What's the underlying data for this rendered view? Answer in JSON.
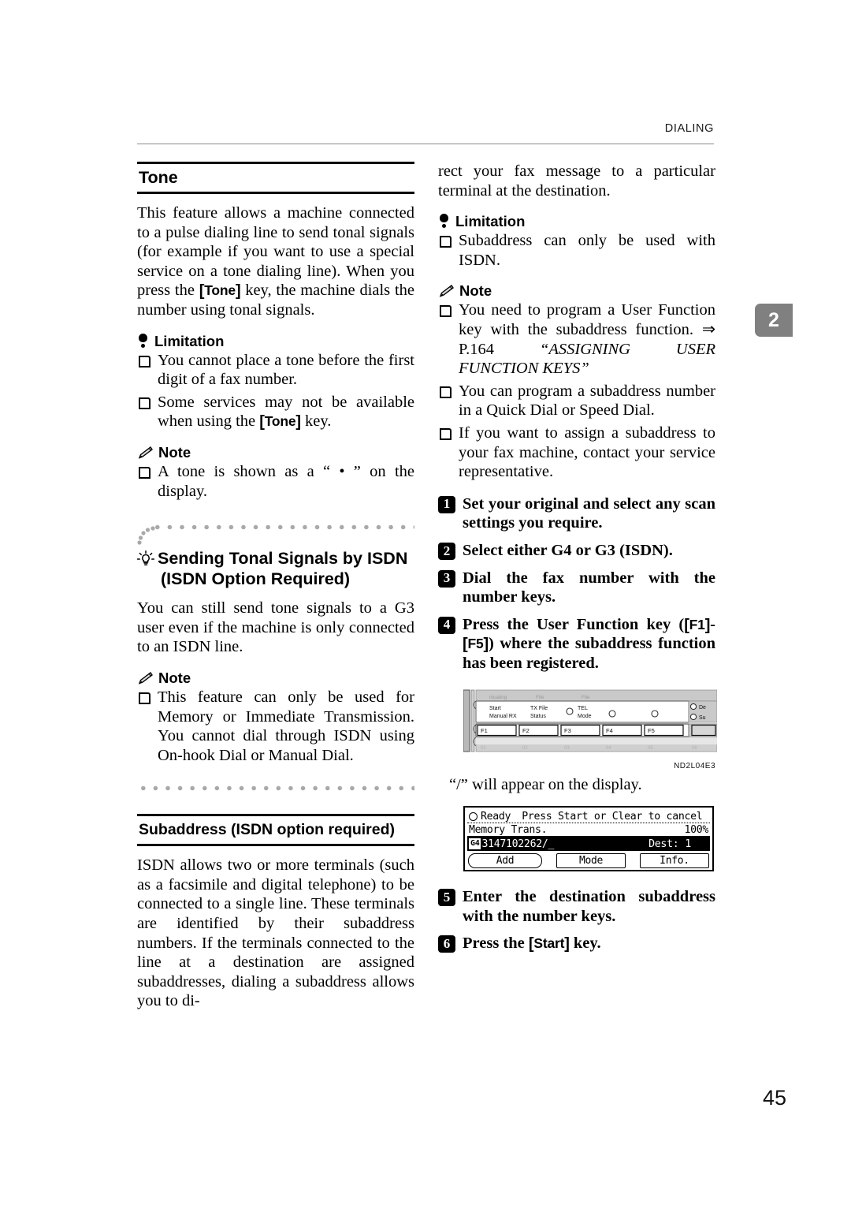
{
  "header": {
    "running_head": "DIALING"
  },
  "chapter_tab": {
    "number": "2"
  },
  "folio": {
    "page_number": "45"
  },
  "left_column": {
    "heading_tone": "Tone",
    "tone_paragraph_1": "This feature allows a machine connected to a pulse dialing line to send tonal signals (for example if you want to use a special service on a tone dialing line). When you press the ",
    "tone_keycap": "Tone",
    "tone_paragraph_2": " key, the machine dials the number using tonal signals.",
    "limitation_label": "Limitation",
    "limitation_items": [
      "You cannot place a tone before the first digit of a fax number.",
      "Some services may not be available when using the "
    ],
    "limitation_item2_keycap": "Tone",
    "limitation_item2_tail": " key.",
    "note_label": "Note",
    "note_items": [
      "A tone is shown as a “ • ” on the display."
    ],
    "heading_isdn_line1": "Sending Tonal Signals by ISDN",
    "heading_isdn_line2": "(ISDN Option Required)",
    "isdn_paragraph": "You can still send tone signals to a G3 user even if the machine is only connected to an ISDN line.",
    "note2_label": "Note",
    "note2_items": [
      "This feature can only be used for Memory or Immediate Transmission. You cannot dial through ISDN using On-hook Dial or Manual Dial."
    ],
    "heading_subaddress": "Subaddress (ISDN option required)",
    "subaddress_paragraph": "ISDN allows two or more terminals (such as a facsimile and digital telephone) to be connected to a single line. These terminals are identified by their subaddress numbers. If the terminals connected to the line at a destination are assigned subaddresses, dialing a subaddress allows you to di-"
  },
  "right_column": {
    "continued_paragraph": "rect your fax message to a particular terminal at the destination.",
    "limitation_label": "Limitation",
    "limitation_items": [
      "Subaddress can only be used with ISDN."
    ],
    "note_label": "Note",
    "note_item_1_pre": "You need to program a User Function key with the subaddress function. ⇒ P.164 ",
    "note_item_1_italic": "“ASSIGNING USER FUNCTION KEYS”",
    "note_items_rest": [
      "You can program a subaddress number in a Quick Dial or Speed Dial.",
      "If you want to assign a subaddress to your fax machine, contact your service representative."
    ],
    "steps": [
      {
        "num": "1",
        "text": "Set your original and select any scan settings you require."
      },
      {
        "num": "2",
        "text": "Select either G4 or G3 (ISDN)."
      },
      {
        "num": "3",
        "text": "Dial the fax number with the number keys."
      }
    ],
    "step4": {
      "num": "4",
      "text_pre": "Press the User Function key (",
      "key1": "F1",
      "dash": "-",
      "key2": "F5",
      "text_post": ") where the subaddress function has been registered."
    },
    "slash_caption": "“/” will appear on the display.",
    "step5": {
      "num": "5",
      "text": "Enter the destination subaddress with the number keys."
    },
    "step6": {
      "num": "6",
      "text_pre": "Press the ",
      "key": "Start",
      "text_post": " key."
    }
  },
  "control_panel_figure": {
    "caption": "ND2L04E3",
    "top_labels": [
      "nicating",
      "File",
      "File"
    ],
    "row_labels": [
      {
        "line1": "Start",
        "line2": "Manual RX"
      },
      {
        "line1": "TX File",
        "line2": "Status"
      },
      {
        "line1": "TEL",
        "line2": "Mode"
      }
    ],
    "function_keys": [
      "F1",
      "F2",
      "F3",
      "F4",
      "F5"
    ],
    "right_labels": [
      "De",
      "Su"
    ]
  },
  "lcd_display": {
    "status_icon": "clock-icon",
    "line1_left": "Ready",
    "line1_right": "Press Start or Clear to cancel",
    "line2_left": "Memory Trans.",
    "line2_right": "100%",
    "line3_badge": "G4",
    "line3_number": "3147102262/_",
    "line3_dest_label": "Dest:",
    "line3_dest_value": "1",
    "buttons": [
      "Add",
      "Mode",
      "Info."
    ]
  },
  "colors": {
    "rule": "#000000",
    "header_rule": "#8a8a8a",
    "tab_bg": "#808080",
    "dots": "#a9a9a9"
  }
}
